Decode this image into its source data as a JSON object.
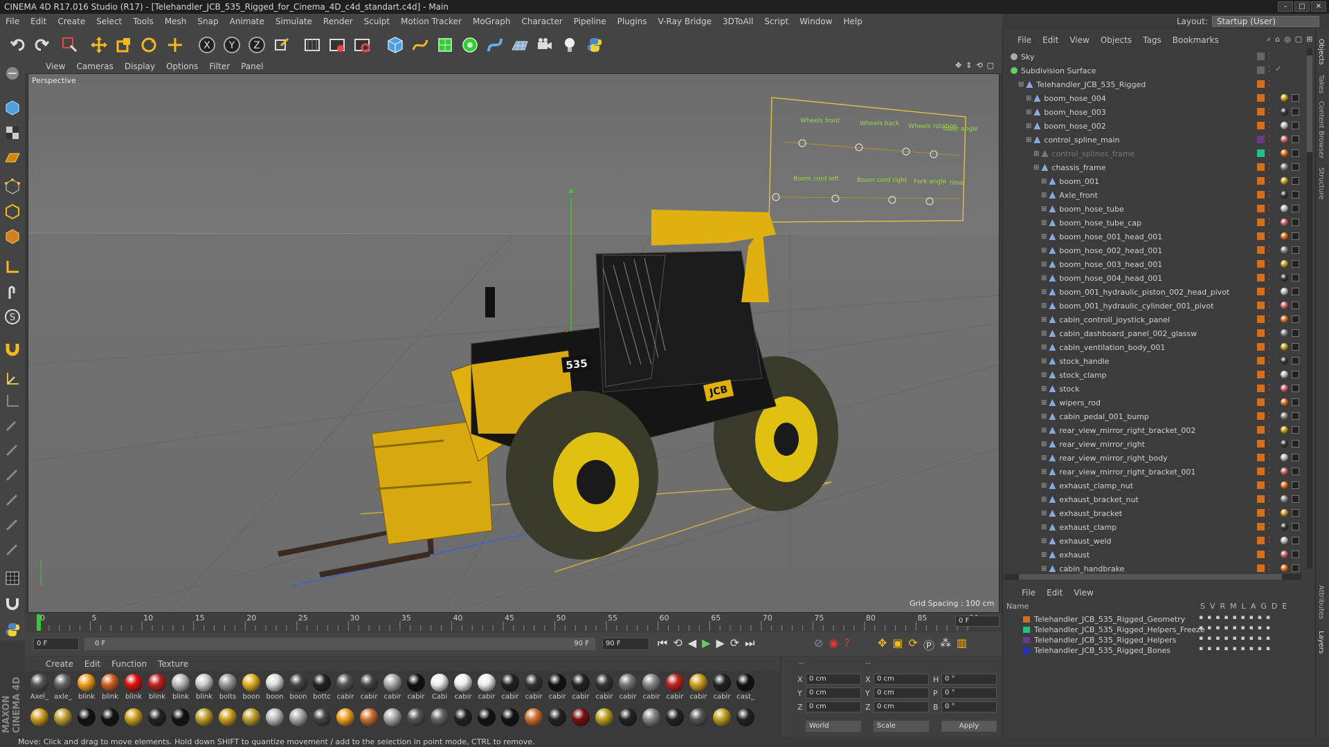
{
  "window": {
    "title": "CINEMA 4D R17.016 Studio (R17) - [Telehandler_JCB_535_Rigged_for_Cinema_4D_c4d_standart.c4d] - Main"
  },
  "menu": [
    "File",
    "Edit",
    "Create",
    "Select",
    "Tools",
    "Mesh",
    "Snap",
    "Animate",
    "Simulate",
    "Render",
    "Sculpt",
    "Motion Tracker",
    "MoGraph",
    "Character",
    "Pipeline",
    "Plugins",
    "V-Ray Bridge",
    "3DToAll",
    "Script",
    "Window",
    "Help"
  ],
  "layout": {
    "label": "Layout:",
    "value": "Startup (User)"
  },
  "viewport": {
    "menu": [
      "View",
      "Cameras",
      "Display",
      "Options",
      "Filter",
      "Panel"
    ],
    "label": "Perspective",
    "grid_spacing": "Grid Spacing : 100 cm"
  },
  "timeline": {
    "ticks": [
      "0",
      "5",
      "10",
      "15",
      "20",
      "25",
      "30",
      "35",
      "40",
      "45",
      "50",
      "55",
      "60",
      "65",
      "70",
      "75",
      "80",
      "85",
      "90"
    ],
    "current_frame": "0 F",
    "start_field": "0 F",
    "range_start": "0 F",
    "range_end": "90 F",
    "end_field": "90 F"
  },
  "materials": {
    "menu": [
      "Create",
      "Edit",
      "Function",
      "Texture"
    ],
    "row1": [
      {
        "name": "Axel_",
        "color": "#555"
      },
      {
        "name": "axle_",
        "color": "#666"
      },
      {
        "name": "blink",
        "color": "#f0a020"
      },
      {
        "name": "blink",
        "color": "#d06020"
      },
      {
        "name": "blink",
        "color": "#e01010"
      },
      {
        "name": "blink",
        "color": "#c02020"
      },
      {
        "name": "blink",
        "color": "#bbb"
      },
      {
        "name": "blink",
        "color": "#ccc"
      },
      {
        "name": "bolts",
        "color": "#999"
      },
      {
        "name": "boon",
        "color": "#e0b020"
      },
      {
        "name": "boon",
        "color": "#ddd"
      },
      {
        "name": "boon",
        "color": "#444"
      },
      {
        "name": "bottc",
        "color": "#222"
      },
      {
        "name": "cabir",
        "color": "#555"
      },
      {
        "name": "cabir",
        "color": "#444"
      },
      {
        "name": "cabir",
        "color": "#aaa"
      },
      {
        "name": "cabir",
        "color": "#111"
      },
      {
        "name": "Cabi",
        "color": "#eee"
      },
      {
        "name": "cabir",
        "color": "#eee"
      },
      {
        "name": "cabir",
        "color": "#eee"
      },
      {
        "name": "cabir",
        "color": "#222"
      },
      {
        "name": "cabir",
        "color": "#333"
      },
      {
        "name": "cabir",
        "color": "#111"
      },
      {
        "name": "cabir",
        "color": "#222"
      },
      {
        "name": "cabir",
        "color": "#333"
      },
      {
        "name": "cabir",
        "color": "#777"
      },
      {
        "name": "cabir",
        "color": "#888"
      },
      {
        "name": "cabir",
        "color": "#c02020"
      },
      {
        "name": "cabir",
        "color": "#d0a020"
      },
      {
        "name": "cabir",
        "color": "#222"
      },
      {
        "name": "cast_",
        "color": "#111"
      }
    ],
    "row2_colors": [
      "#d0a020",
      "#c0a030",
      "#111",
      "#111",
      "#d0a020",
      "#222",
      "#111",
      "#c0a030",
      "#d0a020",
      "#c0a030",
      "#bbb",
      "#aaa",
      "#444",
      "#f0a020",
      "#d07030",
      "#aaa",
      "#555",
      "#666",
      "#222",
      "#111",
      "#111",
      "#d07030",
      "#222",
      "#7a1010",
      "#c0a020",
      "#222",
      "#888",
      "#222",
      "#555",
      "#c0a020",
      "#222"
    ]
  },
  "coords": {
    "rows": [
      {
        "a": "X",
        "av": "0 cm",
        "b": "X",
        "bv": "0 cm",
        "c": "H",
        "cv": "0 °"
      },
      {
        "a": "Y",
        "av": "0 cm",
        "b": "Y",
        "bv": "0 cm",
        "c": "P",
        "cv": "0 °"
      },
      {
        "a": "Z",
        "av": "0 cm",
        "b": "Z",
        "bv": "0 cm",
        "c": "B",
        "cv": "0 °"
      }
    ],
    "dash1": "--",
    "dash2": "--",
    "mode1": "World",
    "mode2": "Scale",
    "apply": "Apply"
  },
  "objects": {
    "menu": [
      "File",
      "Edit",
      "View",
      "Objects",
      "Tags",
      "Bookmarks"
    ],
    "items": [
      {
        "label": "Sky",
        "indent": 0,
        "color": "#aaa"
      },
      {
        "label": "Subdivision Surface",
        "indent": 0,
        "color": "#6c6"
      },
      {
        "label": "Telehandler_JCB_535_Rigged",
        "indent": 1,
        "color": "#8ad"
      },
      {
        "label": "boom_hose_004",
        "indent": 2,
        "color": "#8ad"
      },
      {
        "label": "boom_hose_003",
        "indent": 2,
        "color": "#8ad"
      },
      {
        "label": "boom_hose_002",
        "indent": 2,
        "color": "#8ad"
      },
      {
        "label": "control_spline_main",
        "indent": 2,
        "color": "#8ad"
      },
      {
        "label": "control_splines_frame",
        "indent": 3,
        "color": "#777"
      },
      {
        "label": "chassis_frame",
        "indent": 3,
        "color": "#8ad"
      },
      {
        "label": "boom_001",
        "indent": 4,
        "color": "#8ad"
      },
      {
        "label": "Axle_front",
        "indent": 4,
        "color": "#8ad"
      },
      {
        "label": "boom_hose_tube",
        "indent": 4,
        "color": "#8ad"
      },
      {
        "label": "boom_hose_tube_cap",
        "indent": 4,
        "color": "#8ad"
      },
      {
        "label": "boom_hose_001_head_001",
        "indent": 4,
        "color": "#8ad"
      },
      {
        "label": "boom_hose_002_head_001",
        "indent": 4,
        "color": "#8ad"
      },
      {
        "label": "boom_hose_003_head_001",
        "indent": 4,
        "color": "#8ad"
      },
      {
        "label": "boom_hose_004_head_001",
        "indent": 4,
        "color": "#8ad"
      },
      {
        "label": "boom_001_hydraulic_piston_002_head_pivot",
        "indent": 4,
        "color": "#8ad"
      },
      {
        "label": "boom_001_hydraulic_cylinder_001_pivot",
        "indent": 4,
        "color": "#8ad"
      },
      {
        "label": "cabin_controll_joystick_panel",
        "indent": 4,
        "color": "#8ad"
      },
      {
        "label": "cabin_dashboard_panel_002_glassw",
        "indent": 4,
        "color": "#8ad"
      },
      {
        "label": "cabin_ventilation_body_001",
        "indent": 4,
        "color": "#8ad"
      },
      {
        "label": "stock_handle",
        "indent": 4,
        "color": "#8ad"
      },
      {
        "label": "stock_clamp",
        "indent": 4,
        "color": "#8ad"
      },
      {
        "label": "stock",
        "indent": 4,
        "color": "#8ad"
      },
      {
        "label": "wipers_rod",
        "indent": 4,
        "color": "#8ad"
      },
      {
        "label": "cabin_pedal_001_bump",
        "indent": 4,
        "color": "#8ad"
      },
      {
        "label": "rear_view_mirror_right_bracket_002",
        "indent": 4,
        "color": "#8ad"
      },
      {
        "label": "rear_view_mirror_right",
        "indent": 4,
        "color": "#8ad"
      },
      {
        "label": "rear_view_mirror_right_body",
        "indent": 4,
        "color": "#8ad"
      },
      {
        "label": "rear_view_mirror_right_bracket_001",
        "indent": 4,
        "color": "#8ad"
      },
      {
        "label": "exhaust_clamp_nut",
        "indent": 4,
        "color": "#8ad"
      },
      {
        "label": "exhaust_bracket_nut",
        "indent": 4,
        "color": "#8ad"
      },
      {
        "label": "exhaust_bracket",
        "indent": 4,
        "color": "#8ad"
      },
      {
        "label": "exhaust_clamp",
        "indent": 4,
        "color": "#8ad"
      },
      {
        "label": "exhaust_weld",
        "indent": 4,
        "color": "#8ad"
      },
      {
        "label": "exhaust",
        "indent": 4,
        "color": "#8ad"
      },
      {
        "label": "cabin_handbrake",
        "indent": 4,
        "color": "#8ad"
      }
    ]
  },
  "layers": {
    "menu": [
      "File",
      "Edit",
      "View"
    ],
    "header": {
      "name": "Name",
      "cols": [
        "S",
        "V",
        "R",
        "M",
        "L",
        "A",
        "G",
        "D",
        "E"
      ]
    },
    "items": [
      {
        "label": "Telehandler_JCB_535_Rigged_Geometry",
        "color": "#d07020"
      },
      {
        "label": "Telehandler_JCB_535_Rigged_Helpers_Freeze",
        "color": "#20c080"
      },
      {
        "label": "Telehandler_JCB_535_Rigged_Helpers",
        "color": "#6a3a8a"
      },
      {
        "label": "Telehandler_JCB_535_Rigged_Bones",
        "color": "#2030c0"
      }
    ]
  },
  "right_tabs": [
    "Objects",
    "Takes",
    "Content Browser",
    "Structure",
    "Attributes",
    "Layers"
  ],
  "status": "Move: Click and drag to move elements. Hold down SHIFT to quantize movement / add to the selection in point mode, CTRL to remove.",
  "branding": "MAXON CINEMA 4D",
  "hud": {
    "labels_top": [
      "Wheels front",
      "Wheels back",
      "Wheels rotation",
      "steer angle"
    ],
    "labels_bottom": [
      "Boom cord left",
      "Boom cord right",
      "Fork angle",
      "time"
    ]
  }
}
